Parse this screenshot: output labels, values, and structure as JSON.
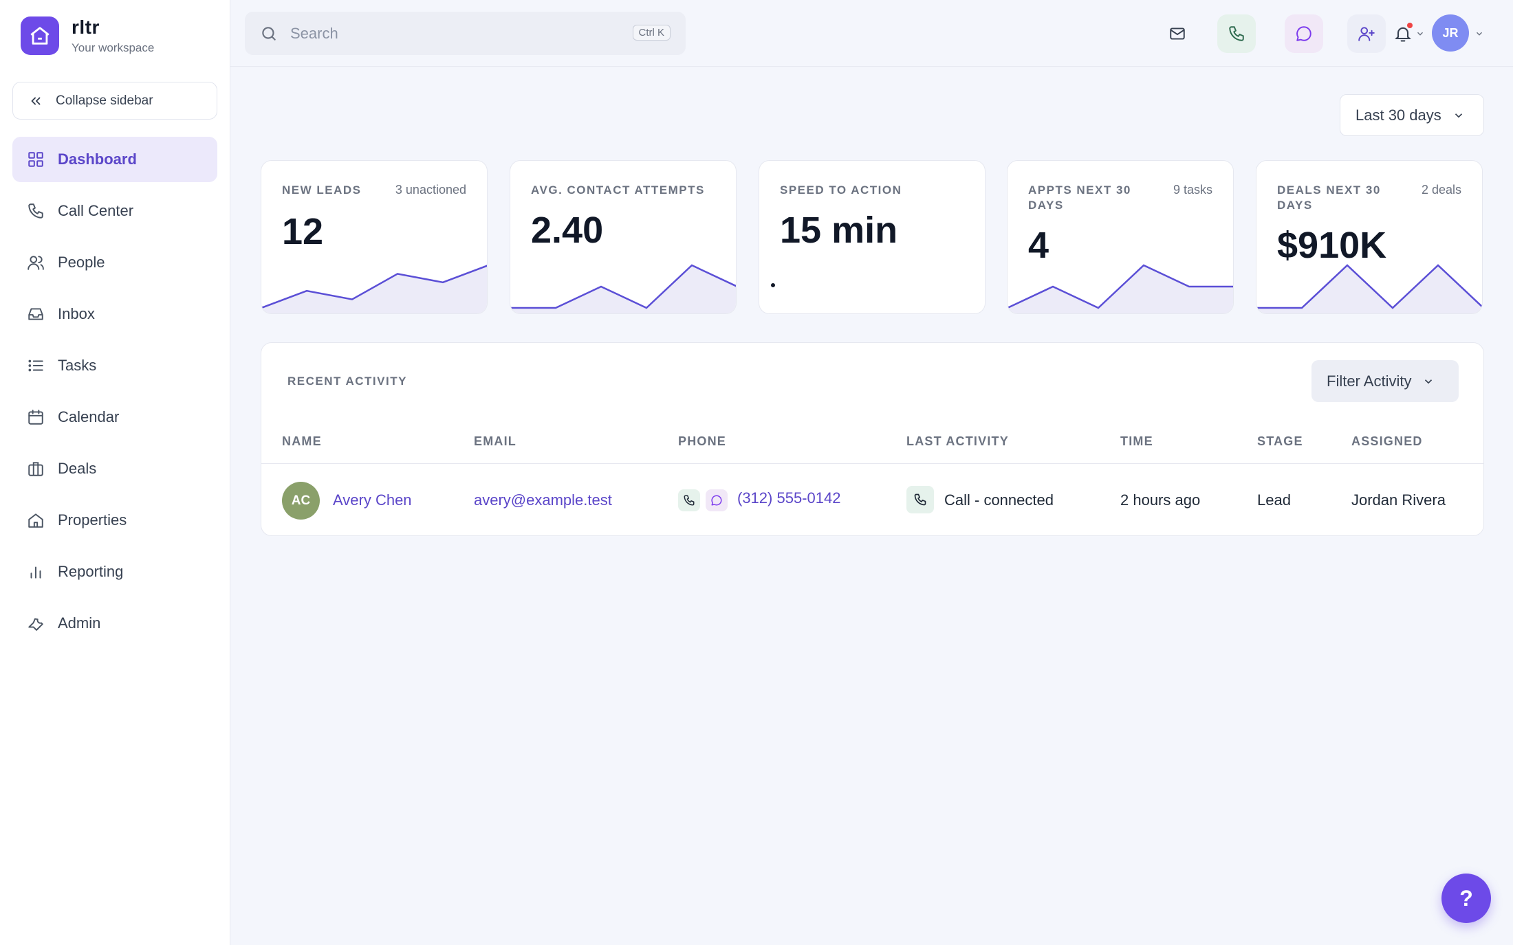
{
  "brand": {
    "name": "rltr",
    "subtitle": "Your workspace"
  },
  "sidebar": {
    "collapse_label": "Collapse sidebar",
    "items": [
      {
        "label": "Dashboard",
        "icon": "grid-icon",
        "active": true
      },
      {
        "label": "Call Center",
        "icon": "phone-icon"
      },
      {
        "label": "People",
        "icon": "users-icon"
      },
      {
        "label": "Inbox",
        "icon": "inbox-icon"
      },
      {
        "label": "Tasks",
        "icon": "list-icon"
      },
      {
        "label": "Calendar",
        "icon": "calendar-icon"
      },
      {
        "label": "Deals",
        "icon": "briefcase-icon"
      },
      {
        "label": "Properties",
        "icon": "home-icon"
      },
      {
        "label": "Reporting",
        "icon": "bar-chart-icon"
      },
      {
        "label": "Admin",
        "icon": "wrench-icon"
      }
    ]
  },
  "topbar": {
    "search_placeholder": "Search",
    "search_shortcut": "Ctrl K",
    "user_initials": "JR"
  },
  "filters": {
    "date_range": "Last 30 days"
  },
  "metrics": [
    {
      "label": "NEW LEADS",
      "sub": "3 unactioned",
      "value": "12"
    },
    {
      "label": "AVG. CONTACT ATTEMPTS",
      "sub": "",
      "value": "2.40"
    },
    {
      "label": "SPEED TO ACTION",
      "sub": "",
      "value": "15 min"
    },
    {
      "label": "APPTS NEXT 30 DAYS",
      "sub": "9 tasks",
      "value": "4"
    },
    {
      "label": "DEALS NEXT 30 DAYS",
      "sub": "2 deals",
      "value": "$910K"
    }
  ],
  "sparklines": [
    [
      3,
      5,
      4,
      7,
      6,
      8
    ],
    [
      4,
      4,
      5,
      4,
      6,
      5
    ],
    [
      0
    ],
    [
      2,
      4,
      2,
      6,
      4,
      4
    ],
    [
      1,
      1,
      5,
      1,
      5,
      1
    ]
  ],
  "activity": {
    "title": "RECENT ACTIVITY",
    "filter_label": "Filter Activity",
    "columns": [
      "NAME",
      "EMAIL",
      "PHONE",
      "LAST ACTIVITY",
      "TIME",
      "STAGE",
      "ASSIGNED"
    ],
    "rows": [
      {
        "initials": "AC",
        "name": "Avery Chen",
        "email": "avery@example.test",
        "phone": "(312) 555-0142",
        "last_activity": "Call - connected",
        "time": "2 hours ago",
        "stage": "Lead",
        "assigned": "Jordan Rivera"
      }
    ]
  },
  "help_label": "?",
  "colors": {
    "accent": "#6d4ae8",
    "spark_line": "#5b4fd6",
    "spark_fill": "#ecebf8"
  }
}
